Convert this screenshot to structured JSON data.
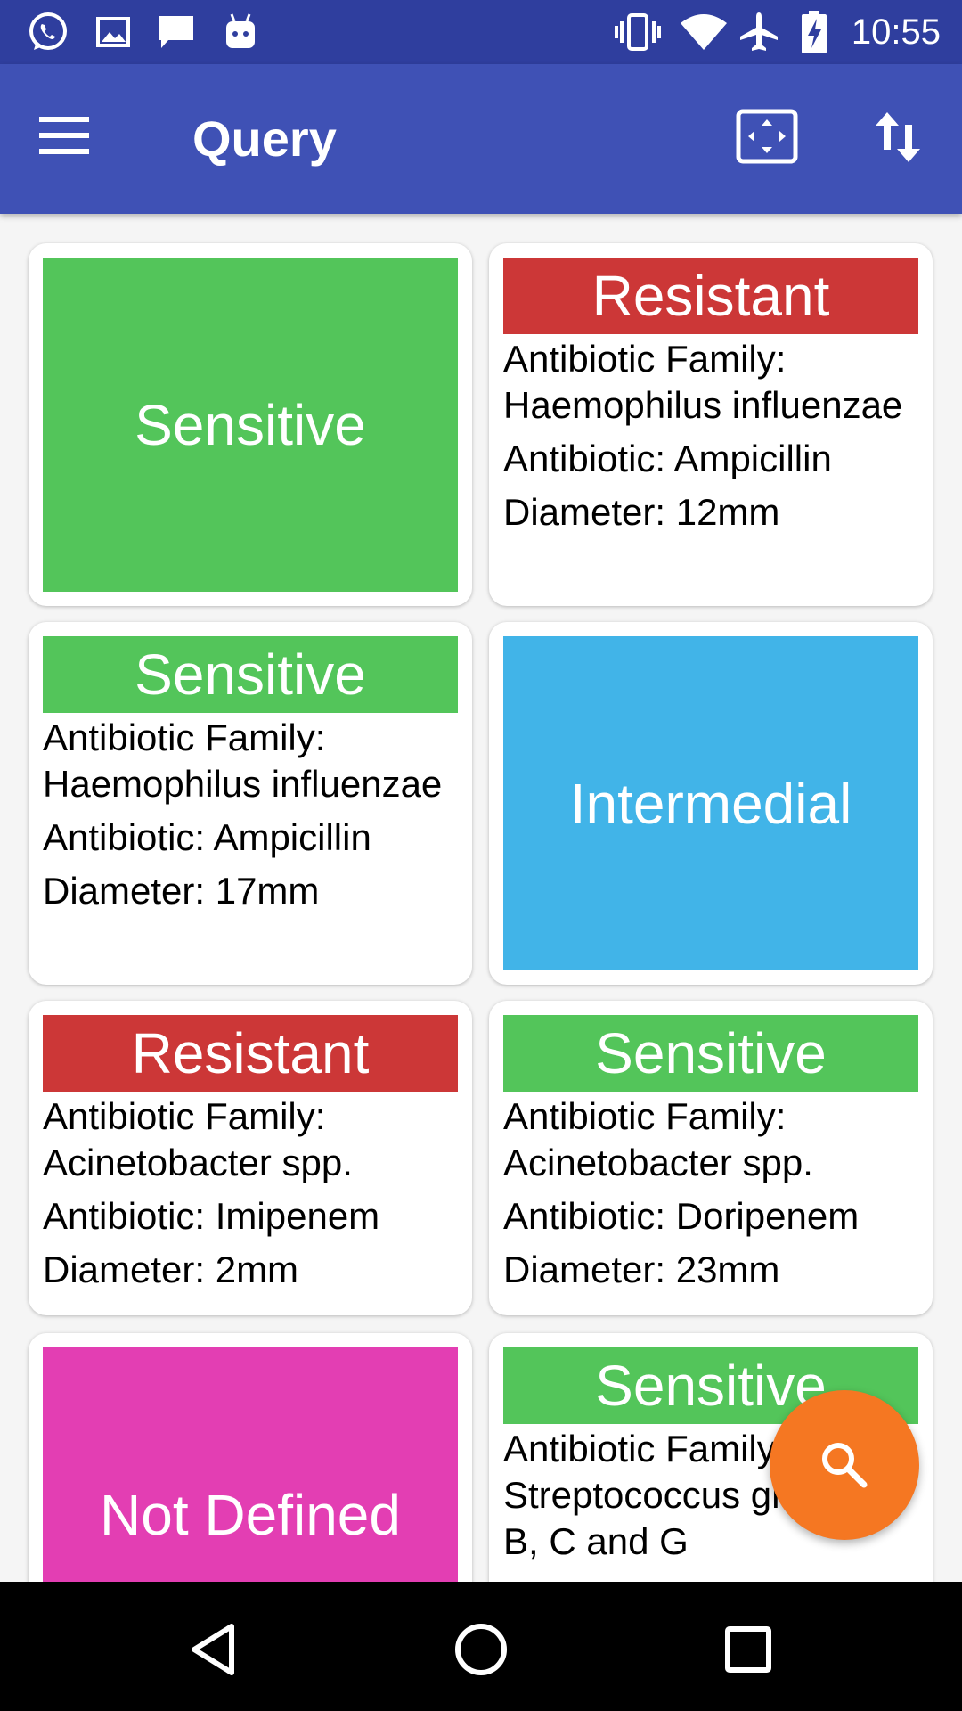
{
  "status_bar": {
    "time": "10:55",
    "left_icons": [
      "whatsapp-icon",
      "gallery-icon",
      "message-icon",
      "android-icon"
    ],
    "right_icons": [
      "vibrate-icon",
      "wifi-icon",
      "airplane-icon",
      "battery-charging-icon"
    ]
  },
  "app_bar": {
    "title": "Query",
    "color": "#3f51b5",
    "actions": [
      "expand-icon",
      "sort-icon"
    ]
  },
  "labels": {
    "family": "Antibiotic Family:",
    "antibiotic": "Antibiotic:",
    "diameter": "Diameter:"
  },
  "results": [
    {
      "status": "Sensitive",
      "expanded": false
    },
    {
      "status": "Resistant",
      "family": "Antibiotic Family: Haemophilus influenzae",
      "antibiotic": "Antibiotic: Ampicillin",
      "diameter": "Diameter: 12mm"
    },
    {
      "status": "Sensitive",
      "family": "Antibiotic Family: Haemophilus influenzae",
      "antibiotic": "Antibiotic: Ampicillin",
      "diameter": "Diameter: 17mm"
    },
    {
      "status": "Intermedial",
      "expanded": false
    },
    {
      "status": "Resistant",
      "family": "Antibiotic Family: Acinetobacter spp.",
      "antibiotic": "Antibiotic: Imipenem",
      "diameter": "Diameter: 2mm"
    },
    {
      "status": "Sensitive",
      "family": "Antibiotic Family: Acinetobacter spp.",
      "antibiotic": "Antibiotic: Doripenem",
      "diameter": "Diameter: 23mm"
    },
    {
      "status": "Not Defined",
      "expanded": false
    },
    {
      "status": "Sensitive",
      "family": "Antibiotic Family: Streptococcus group A, B, C and G",
      "antibiotic": "",
      "diameter": ""
    }
  ],
  "status_colors": {
    "sensitive": "#53c55a",
    "resistant": "#cc3737",
    "intermedial": "#41b4e8",
    "not_defined": "#e33eb3"
  },
  "fab": {
    "icon": "search-icon",
    "color": "#f57722"
  },
  "nav_bar": {
    "buttons": [
      "back-icon",
      "home-icon",
      "recents-icon"
    ]
  }
}
